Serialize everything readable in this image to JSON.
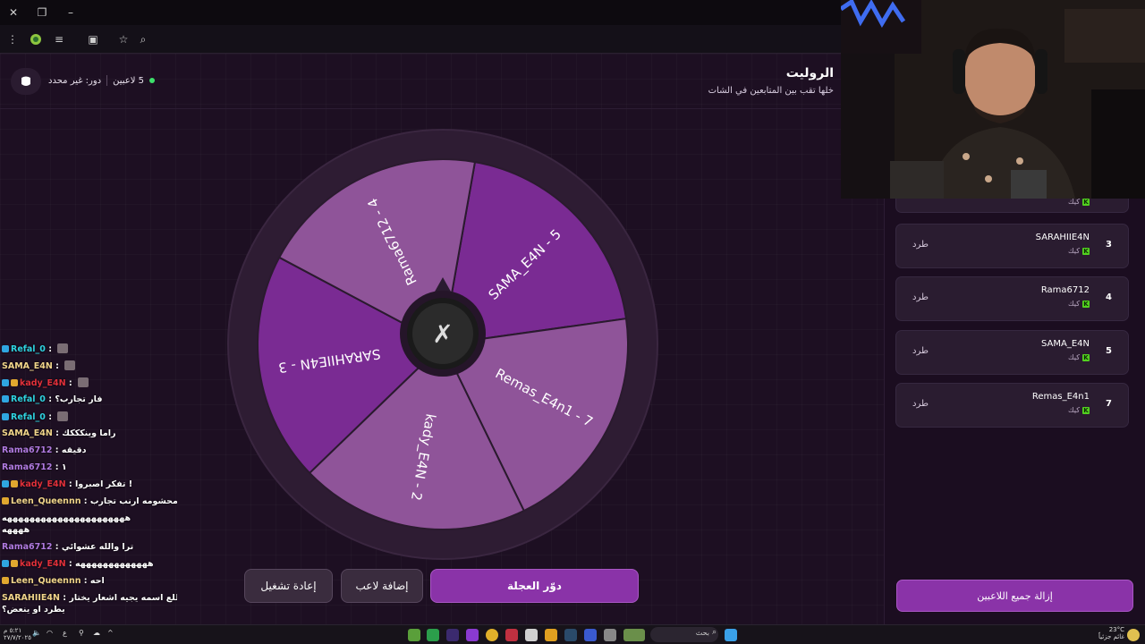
{
  "app": {
    "title": "الروليت",
    "subtitle": "خلها تقب بين المتابعين في الشات",
    "players_count": "5 لاعبين",
    "turn": "دور: غير محدد"
  },
  "wheel": {
    "segments": [
      {
        "label": "SAMA_E4N - 5",
        "color": "#7a2b93"
      },
      {
        "label": "Remas_E4n1 - 7",
        "color": "#8f5499"
      },
      {
        "label": "kady_E4N - 2",
        "color": "#8f5499"
      },
      {
        "label": "SARAHIIE4N - 3",
        "color": "#7a2b93"
      },
      {
        "label": "Rama6712 - 4",
        "color": "#8f5499"
      }
    ],
    "center_icon": "spin-logo-icon"
  },
  "buttons": {
    "spin": "دوّر العجلة",
    "add_player": "إضافة لاعب",
    "restart": "إعادة تشغيل",
    "remove_all": "إزالة جميع اللاعبين"
  },
  "players": [
    {
      "num": "",
      "name": "",
      "platform": "كيك",
      "kick": ""
    },
    {
      "num": "3",
      "name": "SARAHIIE4N",
      "platform": "كيك",
      "kick": "طرد"
    },
    {
      "num": "4",
      "name": "Rama6712",
      "platform": "كيك",
      "kick": "طرد"
    },
    {
      "num": "5",
      "name": "SAMA_E4N",
      "platform": "كيك",
      "kick": "طرد"
    },
    {
      "num": "7",
      "name": "Remas_E4n1",
      "platform": "كيك",
      "kick": "طرد"
    }
  ],
  "chat": [
    {
      "user": "Refal_0",
      "color": "#2fd3e0",
      "msg": "",
      "badges": [
        "blue"
      ],
      "thumb": true
    },
    {
      "user": "SAMA_E4N",
      "color": "#f0d48a",
      "msg": "",
      "badges": [],
      "thumb": true
    },
    {
      "user": "kady_E4N",
      "color": "#e0303a",
      "msg": "",
      "badges": [
        "blue",
        "gold"
      ],
      "thumb": true
    },
    {
      "user": "Refal_0",
      "color": "#2fd3e0",
      "msg": "فار تجارب؟",
      "badges": [
        "blue"
      ],
      "thumb": false
    },
    {
      "user": "Refal_0",
      "color": "#2fd3e0",
      "msg": "",
      "badges": [
        "blue"
      ],
      "thumb": true
    },
    {
      "user": "SAMA_E4N",
      "color": "#f0d48a",
      "msg": "راما وينكككك",
      "badges": [],
      "thumb": false
    },
    {
      "user": "Rama6712",
      "color": "#b07ae0",
      "msg": "دقيقه",
      "badges": [],
      "thumb": false
    },
    {
      "user": "Rama6712",
      "color": "#b07ae0",
      "msg": "١",
      "badges": [],
      "thumb": false
    },
    {
      "user": "kady_E4N",
      "color": "#e0303a",
      "msg": "تفكر اصبروا !",
      "badges": [
        "blue",
        "gold"
      ],
      "thumb": false
    },
    {
      "user": "Leen_Queennn",
      "color": "#f0d48a",
      "msg": "لا لا محشومه ارنب تجارب",
      "badges": [
        "gold"
      ],
      "thumb": false
    },
    {
      "user": "",
      "color": "#fff",
      "msg": "ههههههههههههههههههههههه",
      "badges": [],
      "thumb": false
    },
    {
      "user": "",
      "color": "#fff",
      "msg": "ههههه",
      "badges": [],
      "thumb": false
    },
    {
      "user": "Rama6712",
      "color": "#b07ae0",
      "msg": "ترا والله عشوائي",
      "badges": [],
      "thumb": false
    },
    {
      "user": "kady_E4N",
      "color": "#e0303a",
      "msg": "هههههههههههههه",
      "badges": [
        "blue",
        "gold"
      ],
      "thumb": false
    },
    {
      "user": "Leen_Queennn",
      "color": "#f0d48a",
      "msg": "احه",
      "badges": [
        "gold"
      ],
      "thumb": false
    },
    {
      "user": "SARAHIIE4N",
      "color": "#f0d48a",
      "msg": "الي يطلع اسمه يجيه اشعار يختار",
      "badges": [],
      "thumb": false
    },
    {
      "user": "",
      "color": "#fff",
      "msg": "يطرد او ينعض؟",
      "badges": [],
      "thumb": false
    }
  ],
  "taskbar": {
    "search_placeholder": "بحث",
    "weather": "23°C",
    "weather_sub": "غائم جزئياً",
    "time": "٥:٢١ م",
    "date": "٢٧/٧/٢٠٢٥",
    "lang": "ع"
  },
  "browser": {
    "back_icon": "close-icon",
    "pin_icon": "restore-icon",
    "min_icon": "minimize-icon"
  }
}
